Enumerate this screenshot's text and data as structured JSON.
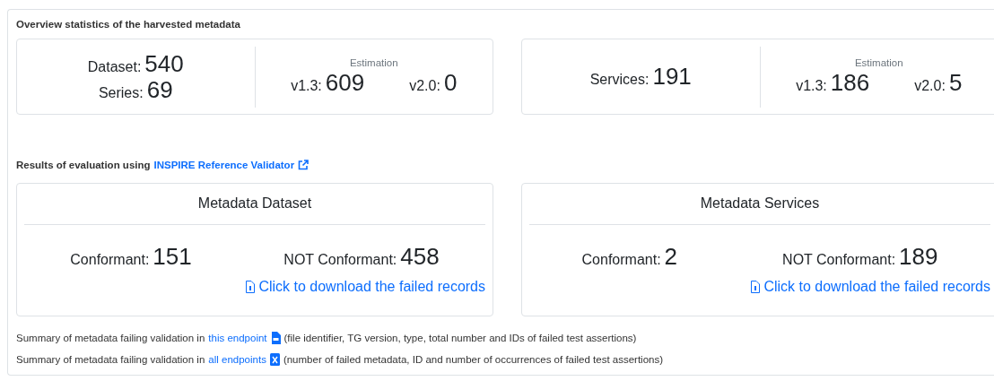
{
  "overview": {
    "title": "Overview statistics of the harvested metadata",
    "cards": [
      {
        "counts": [
          {
            "label": "Dataset:",
            "value": "540"
          },
          {
            "label": "Series:",
            "value": "69"
          }
        ],
        "estimation": {
          "label": "Estimation",
          "items": [
            {
              "label": "v1.3:",
              "value": "609"
            },
            {
              "label": "v2.0:",
              "value": "0"
            }
          ]
        }
      },
      {
        "counts": [
          {
            "label": "Services:",
            "value": "191"
          }
        ],
        "estimation": {
          "label": "Estimation",
          "items": [
            {
              "label": "v1.3:",
              "value": "186"
            },
            {
              "label": "v2.0:",
              "value": "5"
            }
          ]
        }
      }
    ]
  },
  "results": {
    "title": "Results of evaluation using",
    "link": "INSPIRE Reference Validator",
    "cards": [
      {
        "title": "Metadata Dataset",
        "conformant": {
          "label": "Conformant:",
          "value": "151"
        },
        "not_conformant": {
          "label": "NOT Conformant:",
          "value": "458"
        },
        "download": "Click to download the failed records"
      },
      {
        "title": "Metadata Services",
        "conformant": {
          "label": "Conformant:",
          "value": "2"
        },
        "not_conformant": {
          "label": "NOT Conformant:",
          "value": "189"
        },
        "download": "Click to download the failed records"
      }
    ]
  },
  "summary": [
    {
      "prefix": "Summary of metadata failing validation in",
      "link": "this endpoint",
      "kind": "csv",
      "suffix": "(file identifier, TG version, type, total number and IDs of failed test assertions)"
    },
    {
      "prefix": "Summary of metadata failing validation in",
      "link": "all endpoints",
      "kind": "excel",
      "suffix": "(number of failed metadata, ID and number of occurrences of failed test assertions)"
    }
  ]
}
